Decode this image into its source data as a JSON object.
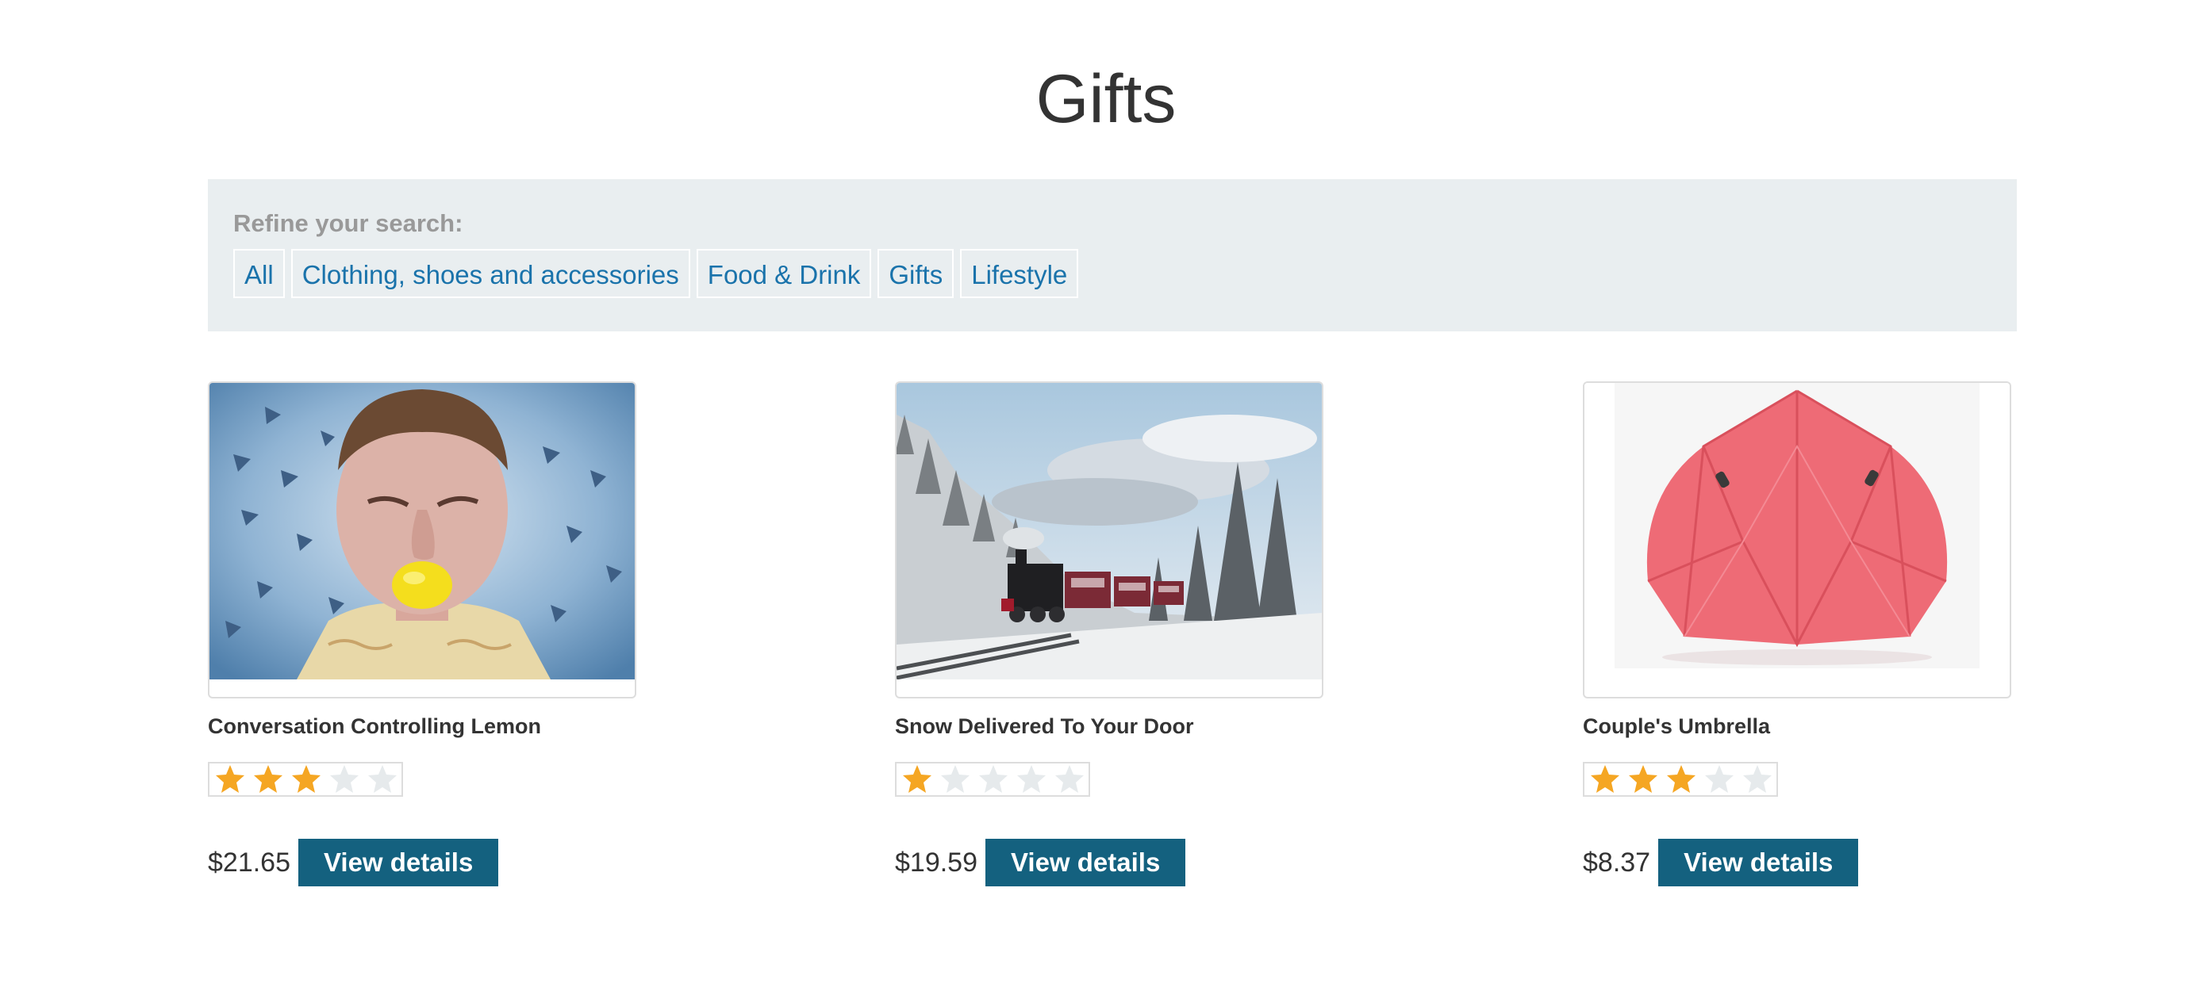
{
  "page": {
    "title": "Gifts"
  },
  "refine": {
    "label": "Refine your search:",
    "filters": [
      "All",
      "Clothing, shoes and accessories",
      "Food & Drink",
      "Gifts",
      "Lifestyle"
    ]
  },
  "products": [
    {
      "name": "Conversation Controlling Lemon",
      "rating": 3,
      "max_rating": 5,
      "price": "$21.65",
      "button_label": "View details",
      "image": "man-biting-lemon-photo"
    },
    {
      "name": "Snow Delivered To Your Door",
      "rating": 1,
      "max_rating": 5,
      "price": "$19.59",
      "button_label": "View details",
      "image": "steam-train-snowy-forest-photo"
    },
    {
      "name": "Couple's Umbrella",
      "rating": 3,
      "max_rating": 5,
      "price": "$8.37",
      "button_label": "View details",
      "image": "red-double-umbrella-photo"
    }
  ],
  "colors": {
    "accent_link": "#1a73ab",
    "button_bg": "#14617f",
    "refine_bg": "#e9eef0",
    "star_filled": "#f5a623",
    "star_empty": "#e6eaec"
  }
}
